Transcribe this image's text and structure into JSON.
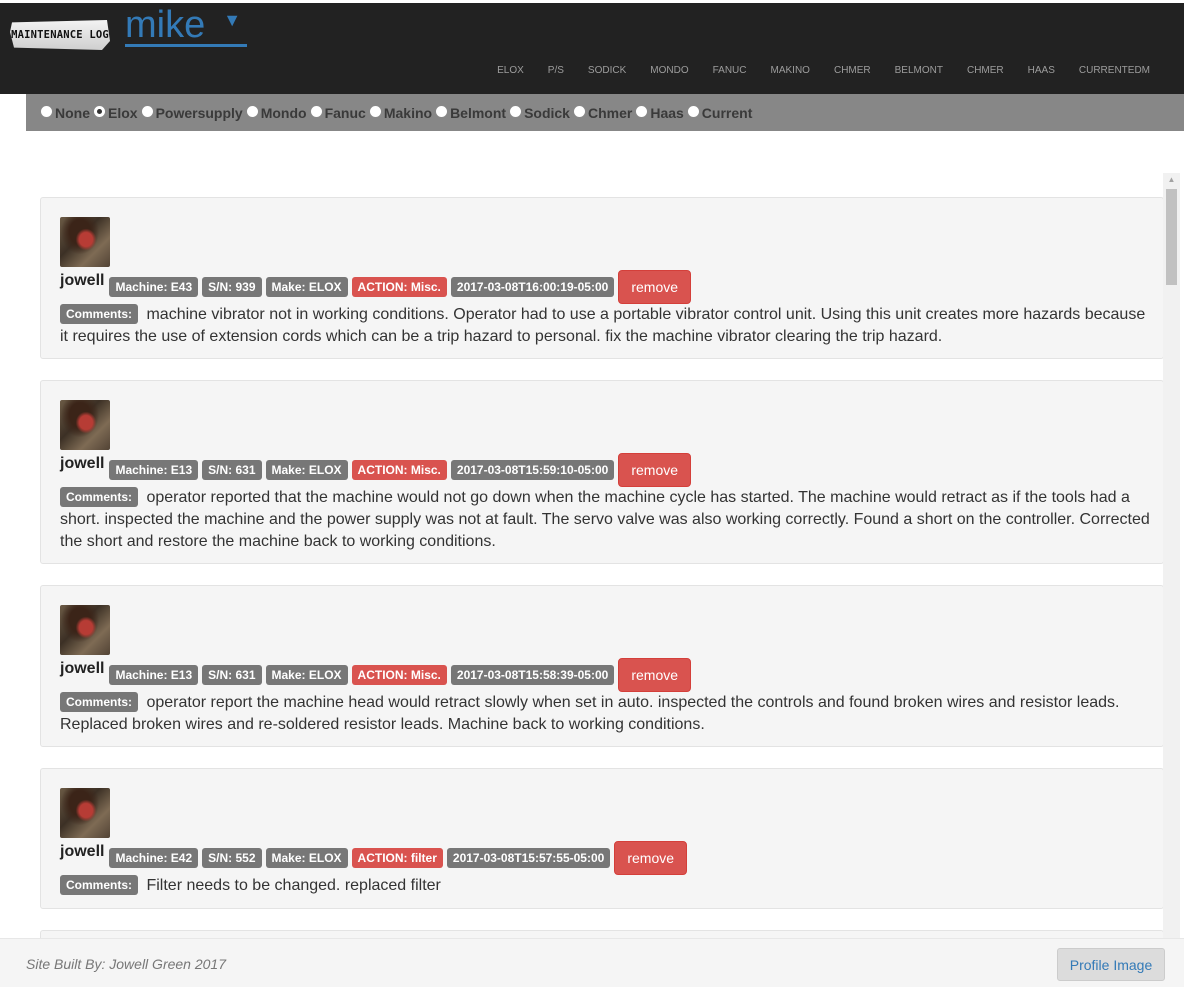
{
  "header": {
    "logo_text": "MAINTENANCE LOG",
    "user": "mike",
    "nav": [
      "ELOX",
      "P/S",
      "SODICK",
      "MONDO",
      "FANUC",
      "MAKINO",
      "CHMER",
      "BELMONT",
      "CHMER",
      "HAAS",
      "CURRENTEDM"
    ]
  },
  "filters": {
    "selected": "Elox",
    "options": [
      "None",
      "Elox",
      "Powersupply",
      "Mondo",
      "Fanuc",
      "Makino",
      "Belmont",
      "Sodick",
      "Chmer",
      "Haas",
      "Current"
    ]
  },
  "entries": [
    {
      "user": "jowell",
      "machine": "Machine: E43",
      "sn": "S/N: 939",
      "make": "Make: ELOX",
      "action": "ACTION: Misc.",
      "timestamp": "2017-03-08T16:00:19-05:00",
      "remove_label": "remove",
      "comments_label": "Comments:",
      "comment": "machine vibrator not in working conditions. Operator had to use a portable vibrator control unit. Using this unit creates more hazards because it requires the use of extension cords which can be a trip hazard to personal. fix the machine vibrator clearing the trip hazard."
    },
    {
      "user": "jowell",
      "machine": "Machine: E13",
      "sn": "S/N: 631",
      "make": "Make: ELOX",
      "action": "ACTION: Misc.",
      "timestamp": "2017-03-08T15:59:10-05:00",
      "remove_label": "remove",
      "comments_label": "Comments:",
      "comment": "operator reported that the machine would not go down when the machine cycle has started. The machine would retract as if the tools had a short. inspected the machine and the power supply was not at fault. The servo valve was also working correctly. Found a short on the controller. Corrected the short and restore the machine back to working conditions."
    },
    {
      "user": "jowell",
      "machine": "Machine: E13",
      "sn": "S/N: 631",
      "make": "Make: ELOX",
      "action": "ACTION: Misc.",
      "timestamp": "2017-03-08T15:58:39-05:00",
      "remove_label": "remove",
      "comments_label": "Comments:",
      "comment": "operator report the machine head would retract slowly when set in auto. inspected the controls and found broken wires and resistor leads. Replaced broken wires and re-soldered resistor leads. Machine back to working conditions."
    },
    {
      "user": "jowell",
      "machine": "Machine: E42",
      "sn": "S/N: 552",
      "make": "Make: ELOX",
      "action": "ACTION: filter",
      "timestamp": "2017-03-08T15:57:55-05:00",
      "remove_label": "remove",
      "comments_label": "Comments:",
      "comment": "Filter needs to be changed. replaced filter"
    }
  ],
  "footer": {
    "credit": "Site Built By: Jowell Green 2017",
    "profile_button": "Profile Image"
  }
}
